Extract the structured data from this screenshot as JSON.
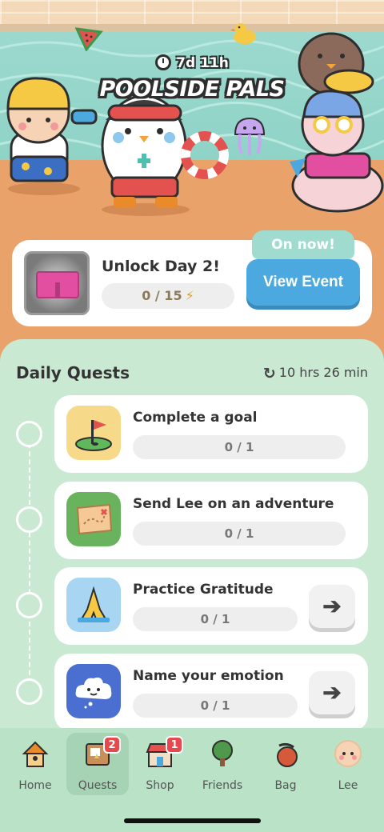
{
  "event": {
    "timer": "7d 11h",
    "title": "POOLSIDE PALS",
    "unlock_label": "Unlock Day 2!",
    "progress": "0 / 15",
    "badge": "On now!",
    "view_button": "View Event"
  },
  "daily_quests": {
    "title": "Daily Quests",
    "reset_timer": "10 hrs 26 min",
    "items": [
      {
        "name": "Complete a goal",
        "progress": "0 / 1",
        "icon": "golf-flag-icon",
        "has_arrow": false
      },
      {
        "name": "Send Lee on an adventure",
        "progress": "0 / 1",
        "icon": "treasure-map-icon",
        "has_arrow": false
      },
      {
        "name": "Practice Gratitude",
        "progress": "0 / 1",
        "icon": "praying-hands-icon",
        "has_arrow": true
      },
      {
        "name": "Name your emotion",
        "progress": "0 / 1",
        "icon": "cloud-face-icon",
        "has_arrow": true
      }
    ]
  },
  "nav": {
    "items": [
      {
        "label": "Home",
        "icon": "house-icon",
        "badge": ""
      },
      {
        "label": "Quests",
        "icon": "quest-board-icon",
        "badge": "2"
      },
      {
        "label": "Shop",
        "icon": "shop-icon",
        "badge": "1"
      },
      {
        "label": "Friends",
        "icon": "tree-icon",
        "badge": ""
      },
      {
        "label": "Bag",
        "icon": "bag-icon",
        "badge": ""
      },
      {
        "label": "Lee",
        "icon": "lee-avatar-icon",
        "badge": ""
      }
    ],
    "active": "Quests"
  },
  "colors": {
    "pool_water": "#8fd3c7",
    "deck": "#e9a36a",
    "panel": "#c9e9d3",
    "view_event_button": "#4ba9df",
    "badge": "#e5484d"
  }
}
